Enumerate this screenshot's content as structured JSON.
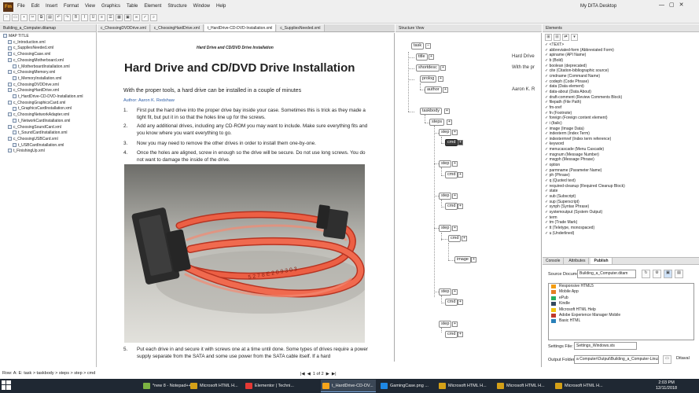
{
  "app": {
    "logo_text": "Fm",
    "workspace": "My DITA Desktop",
    "window_controls": [
      "—",
      "▢",
      "✕"
    ]
  },
  "menu": [
    "File",
    "Edit",
    "Insert",
    "Format",
    "View",
    "Graphics",
    "Table",
    "Element",
    "Structure",
    "Window",
    "Help"
  ],
  "left_panel": {
    "tab": "Building_a_Computer.ditamap",
    "items": [
      {
        "label": "MAP TITLE",
        "indent": 0
      },
      {
        "label": "c_Introduction.xml",
        "indent": 1
      },
      {
        "label": "c_SuppliesNeeded.xml",
        "indent": 1
      },
      {
        "label": "c_ChoosingCase.xml",
        "indent": 1
      },
      {
        "label": "c_ChoosingMotherboard.xml",
        "indent": 1
      },
      {
        "label": "t_MotherboardInstallation.xml",
        "indent": 2
      },
      {
        "label": "c_ChoosingMemory.xml",
        "indent": 1
      },
      {
        "label": "t_MemoryInstallation.xml",
        "indent": 2
      },
      {
        "label": "c_ChoosingDVDDrive.xml",
        "indent": 1
      },
      {
        "label": "c_ChoosingHardDrive.xml",
        "indent": 1
      },
      {
        "label": "t_HardDrive-CD-DVD-Installation.xml",
        "indent": 2
      },
      {
        "label": "c_ChoosingGraphicsCard.xml",
        "indent": 1
      },
      {
        "label": "t_GraphicsCardInstallation.xml",
        "indent": 2
      },
      {
        "label": "c_ChoosingNetworkAdapter.xml",
        "indent": 1
      },
      {
        "label": "t_NetworkCardInstallation.xml",
        "indent": 2
      },
      {
        "label": "c_ChoosingSoundCard.xml",
        "indent": 1
      },
      {
        "label": "t_SoundCardInstallation.xml",
        "indent": 2
      },
      {
        "label": "c_ChoosingUSBCard.xml",
        "indent": 1
      },
      {
        "label": "t_USBCardInstallation.xml",
        "indent": 2
      },
      {
        "label": "t_FinishingUp.xml",
        "indent": 1
      }
    ]
  },
  "doc_tabs": [
    "c_ChoosingDVDDrive.xml",
    "c_ChoosingHardDrive.xml",
    "t_HardDrive-CD-DVD-Installation.xml",
    "c_SuppliesNeeded.xml"
  ],
  "document": {
    "running_head": "Hard Drive and CD/DVD Drive Installation",
    "title": "Hard Drive and CD/DVD Drive Installation",
    "shortdesc": "With the proper tools, a hard drive can be installed in a couple of minutes",
    "author": "Author: Aaron K. Redshaw",
    "steps": [
      {
        "num": "1.",
        "text": "First put the hard drive into the proper drive bay inside your case. Sometimes this is trick as they made a tight fit, but put it in so that the holes line up for the screws."
      },
      {
        "num": "2.",
        "text": "Add any additional drives, including any CD-ROM you may want to include. Make sure everything fits and you know where you want everything to go."
      },
      {
        "num": "3.",
        "text": "Now you may need to remove the other drives in order to install them one-by-one."
      },
      {
        "num": "4.",
        "text": "Once the holes are aligned, screw in enough so the drive will be secure. Do not use long screws. You do not want to damage the inside of the drive."
      },
      {
        "num": "5.",
        "text": "Put each drive in and secure it with screws one at a time until done. Some types of drives require a power supply separate from the SATA and some use power from the SATA cable itself. If a hard"
      }
    ],
    "cable_print": "5 2 7 8  E 2 0 9 3 0 3"
  },
  "status": {
    "path": "Row: A: E: task > taskbody > steps > step > cmd",
    "page": "1 of 2"
  },
  "structure": {
    "header": "Structure View",
    "nodes": {
      "task": "task",
      "title": "title",
      "shortdesc": "shortdesc",
      "prolog": "prolog",
      "author": "author",
      "taskbody": "taskbody",
      "steps": "steps",
      "step": "step",
      "cmd": "cmd",
      "image": "image"
    },
    "texts": {
      "title_txt": "Hard Drive",
      "short_txt": "With the pr",
      "author_txt": "Aaron K. R"
    }
  },
  "elements": {
    "header": "Elements",
    "items": [
      "<TEXT>",
      "abbreviated-form  (Abbreviated Form)",
      "apiname  (API Name)",
      "b  (Bold)",
      "boolean  (deprecated)",
      "cite  (Citation-bibliographic source)",
      "cmdname  (Command Name)",
      "codeph  (Code Phrase)",
      "data  (Data element)",
      "data-about  (Data About)",
      "draft-comment  (Review Comments Block)",
      "filepath  (File Path)",
      "fm-xref",
      "fn  (Footnote)",
      "foreign  (Foreign content element)",
      "i  (Italic)",
      "image  (Image Data)",
      "indexterm  (Index Term)",
      "indextermref  (Index term reference)",
      "keyword",
      "menucascade  (Menu Cascade)",
      "msgnum  (Message Number)",
      "msgph  (Message Phrase)",
      "option",
      "parmname  (Parameter Name)",
      "ph  (Phrase)",
      "q  (Quoted text)",
      "required-cleanup  (Required Cleanup Block)",
      "state",
      "sub  (Subscript)",
      "sup  (Superscript)",
      "synph  (Syntax Phrase)",
      "systemoutput  (System Output)",
      "term",
      "tm  (Trade Mark)",
      "tt  (Teletype, monospaced)",
      "u  (Underlined)"
    ]
  },
  "publish": {
    "tabs": [
      "Console",
      "Attributes",
      "Publish"
    ],
    "source_label": "Source Document:",
    "source_value": "Building_a_Computer.ditam",
    "formats": [
      {
        "label": "Responsive HTML5",
        "color": "#f39c12"
      },
      {
        "label": "Mobile App",
        "color": "#e67e22"
      },
      {
        "label": "ePub",
        "color": "#27ae60"
      },
      {
        "label": "Kindle",
        "color": "#34495e"
      },
      {
        "label": "Microsoft HTML Help",
        "color": "#f1c40f"
      },
      {
        "label": "Adobe Experience Manager Mobile",
        "color": "#c0392b"
      },
      {
        "label": "Basic HTML",
        "color": "#2980b9"
      }
    ],
    "settings_label": "Settings File:",
    "settings_value": "Settings_Windows.sts",
    "output_label": "Output Folder:",
    "output_value": "a Computer\\Output\\Building_a_Computer-Linux",
    "ditaval": "Ditaval"
  },
  "taskbar": {
    "items": [
      {
        "label": "*new 8 - Notepad++",
        "color": "#7cb342"
      },
      {
        "label": "Microsoft HTML H...",
        "color": "#d4a017"
      },
      {
        "label": "Elementor | Techni...",
        "color": "#e53935"
      },
      {
        "label": "t_HardDrive-CD-DV...",
        "color": "#f7a51b"
      },
      {
        "label": "GamingCase.png ...",
        "color": "#1e88e5"
      },
      {
        "label": "Microsoft HTML H...",
        "color": "#d4a017"
      },
      {
        "label": "Microsoft HTML H...",
        "color": "#d4a017"
      },
      {
        "label": "Microsoft HTML H...",
        "color": "#d4a017"
      }
    ],
    "time": "2:03 PM",
    "date": "12/11/2018"
  }
}
